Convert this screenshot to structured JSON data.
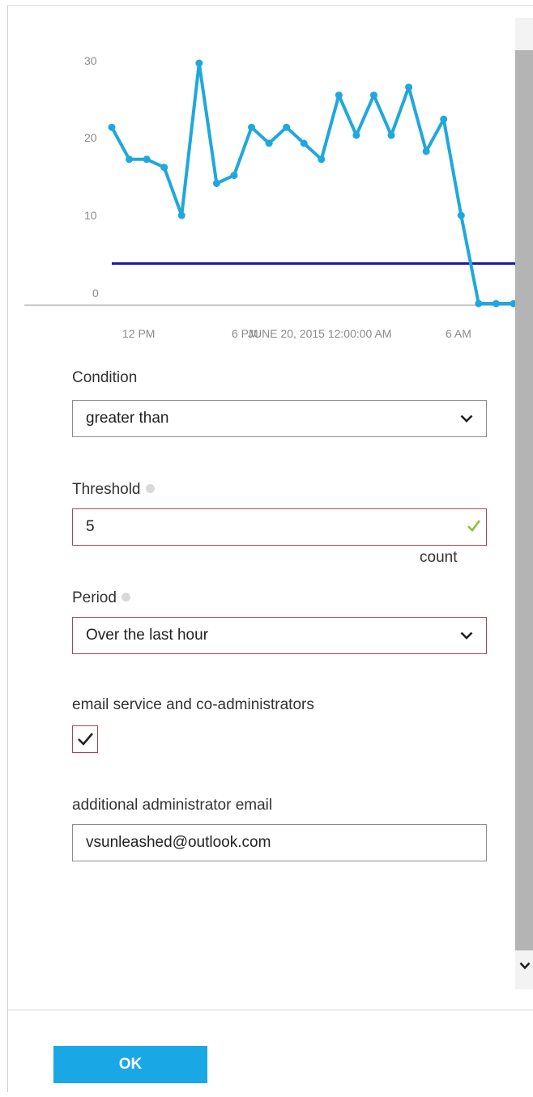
{
  "chart_data": {
    "type": "line",
    "y_ticks": [
      "30",
      "20",
      "10",
      "0"
    ],
    "x_ticks": [
      "12 PM",
      "6 PM",
      "6 AM"
    ],
    "hover_label": "JUNE 20, 2015 12:00:00 AM",
    "ylim": [
      0,
      30
    ],
    "threshold": 5,
    "series": [
      {
        "values": [
          22,
          18,
          18,
          17,
          11,
          30,
          15,
          16,
          22,
          20,
          22,
          20,
          18,
          26,
          21,
          26,
          21,
          27,
          19,
          23,
          11,
          0,
          0,
          0
        ]
      }
    ],
    "colors": {
      "series": "#1fa8dc",
      "threshold": "#1a1aa6",
      "axis": "#c8c8c8"
    }
  },
  "form": {
    "condition": {
      "label": "Condition",
      "value": "greater than"
    },
    "threshold": {
      "label": "Threshold",
      "value": "5",
      "unit": "count"
    },
    "period": {
      "label": "Period",
      "value": "Over the last hour"
    },
    "email_service": {
      "label": "email service and co-administrators",
      "checked": true
    },
    "additional_email": {
      "label": "additional administrator email",
      "value": "vsunleashed@outlook.com"
    }
  },
  "footer": {
    "ok_label": "OK"
  },
  "icons": {
    "dropdown": "chevron-down-icon",
    "valid": "check-icon",
    "info": "info-icon",
    "scroll": "scroll-down-icon"
  }
}
